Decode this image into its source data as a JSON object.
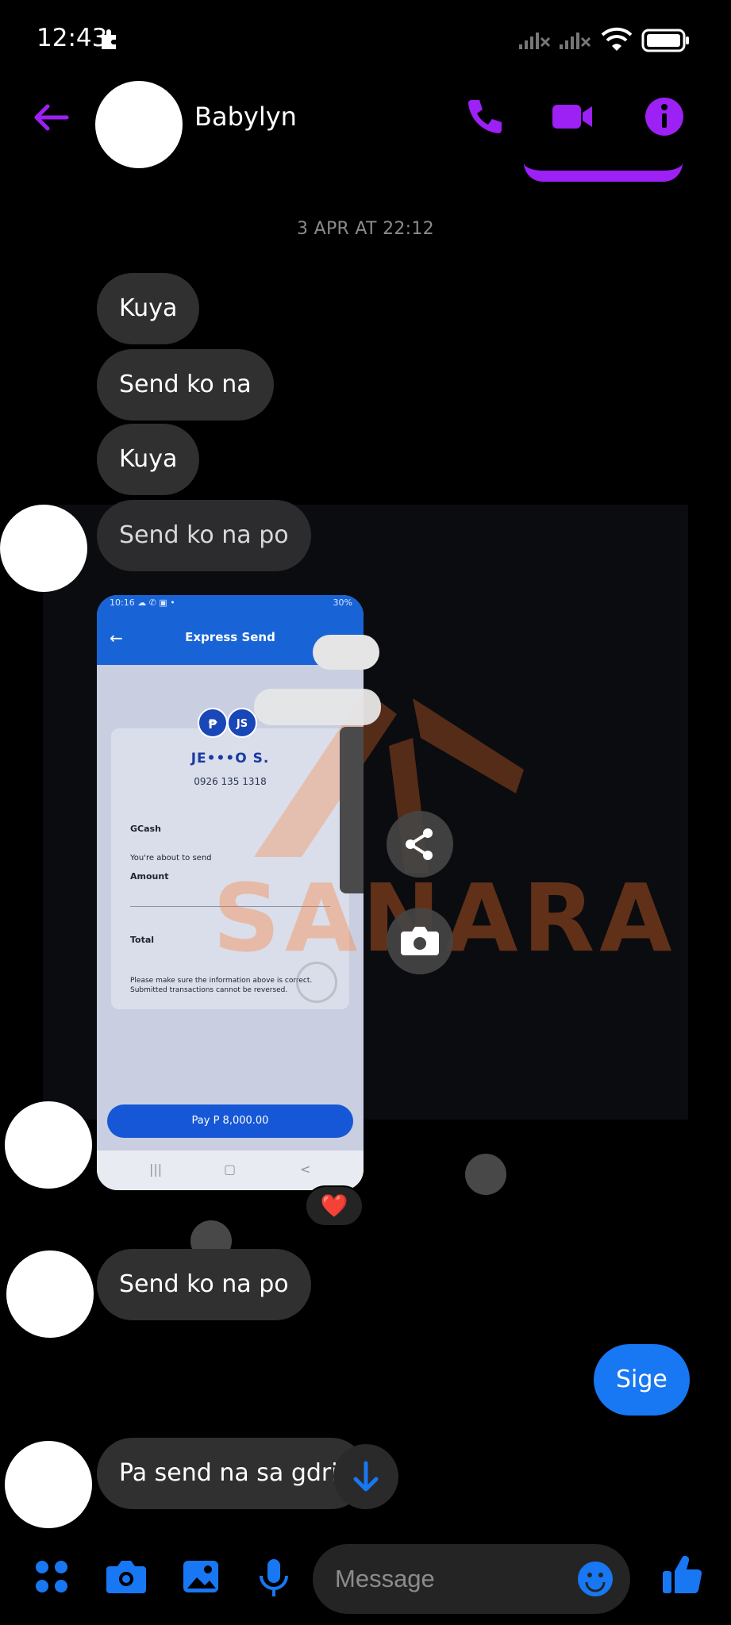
{
  "status_bar": {
    "time": "12:43",
    "icons": [
      "notification-icon",
      "signal-off-icon",
      "signal-off-icon",
      "wifi-icon",
      "battery-icon"
    ]
  },
  "header": {
    "contact_name": "Babylyn",
    "actions": [
      "back-arrow-icon",
      "phone-icon",
      "video-icon",
      "info-icon"
    ],
    "accent_color": "#9d20f5"
  },
  "conversation": {
    "date_separator": "3 APR AT 22:12",
    "messages_1": [
      "Kuya",
      "Send ko na",
      "Kuya",
      "Send ko na po"
    ],
    "messages_2": [
      "Send ko na po"
    ],
    "sent_message": "Sige",
    "last_message": "Pa send na sa gdriv",
    "reaction": "❤️"
  },
  "screenshot": {
    "status_text": "10:16 ☁ ✆ ▣ •",
    "battery_text": "30%",
    "title": "Express Send",
    "logo_letter": "₱",
    "logo_initials": "JS",
    "recipient": "JE•••O S.",
    "number": "0926 135 1318",
    "source": "GCash",
    "about_to_send": "You're about to send",
    "amount_label": "Amount",
    "total_label": "Total",
    "note": "Please make sure the information above is correct. Submitted transactions cannot be reversed.",
    "pay_button": "Pay P 8,000.00",
    "nav": [
      "|||",
      "▢",
      "<"
    ]
  },
  "watermark": "SANARA",
  "composer": {
    "placeholder": "Message",
    "icons": [
      "apps-icon",
      "camera-icon",
      "gallery-icon",
      "microphone-icon",
      "emoji-icon",
      "like-icon"
    ],
    "accent_color": "#1877f2"
  }
}
